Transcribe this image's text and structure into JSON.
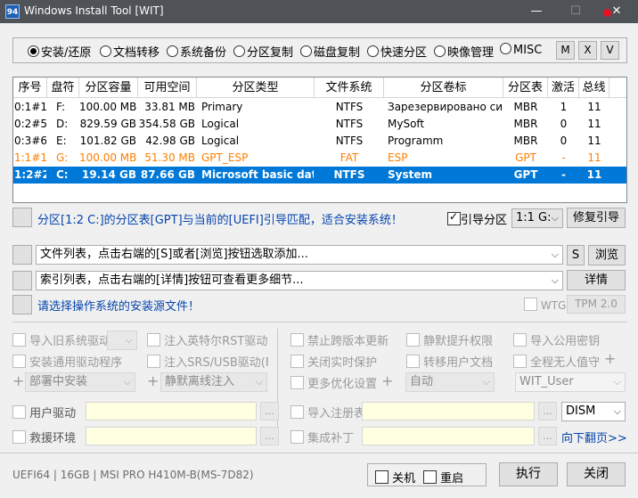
{
  "window": {
    "title": "Windows Install Tool [WIT]",
    "icon_label": "94",
    "minimize": "—",
    "maximize": "☐",
    "close": "✕",
    "close_dot_color": "#e81123"
  },
  "modes": {
    "options": [
      "安装/还原",
      "文档转移",
      "系统备份",
      "分区复制",
      "磁盘复制",
      "快速分区",
      "映像管理",
      "MISC"
    ],
    "selected_index": 0,
    "buttons": [
      "M",
      "X",
      "V"
    ]
  },
  "table": {
    "columns": [
      "序号",
      "盘符",
      "分区容量",
      "可用空间",
      "分区类型",
      "文件系统",
      "分区卷标",
      "分区表",
      "激活",
      "总线"
    ],
    "rows": [
      [
        "0:1#1",
        "F:",
        "100.00 MB",
        "33.81 MB",
        "Primary",
        "NTFS",
        "Зарезервировано сис",
        "MBR",
        "1",
        "11"
      ],
      [
        "0:2#5",
        "D:",
        "829.59 GB",
        "354.58 GB",
        "Logical",
        "NTFS",
        "MySoft",
        "MBR",
        "0",
        "11"
      ],
      [
        "0:3#6",
        "E:",
        "101.82 GB",
        "42.98 GB",
        "Logical",
        "NTFS",
        "Programm",
        "MBR",
        "0",
        "11"
      ],
      [
        "1:1#1",
        "G:",
        "100.00 MB",
        "51.30 MB",
        "GPT_ESP",
        "FAT",
        "ESP",
        "GPT",
        "-",
        "11"
      ],
      [
        "1:2#2",
        "C:",
        "19.14 GB",
        "87.66 GB",
        "Microsoft basic data",
        "NTFS",
        "System",
        "GPT",
        "-",
        "11"
      ]
    ],
    "selected_row": 4,
    "highlight_row": 3,
    "colors": {
      "selected_bg": "#0078d7",
      "esp_text": "#ff7f00"
    }
  },
  "status_line": {
    "text": "分区[1:2 C:]的分区表[GPT]与当前的[UEFI]引导匹配，适合安装系统！",
    "boot_checkbox_label": "引导分区",
    "boot_select": "1:1 G:",
    "repair_button": "修复引导"
  },
  "file_list": {
    "placeholder": "文件列表，点击右端的[S]或者[浏览]按钮选取添加...",
    "s_button": "S",
    "browse_button": "浏览"
  },
  "index_list": {
    "placeholder": "索引列表，点击右端的[详情]按钮可查看更多细节...",
    "detail_button": "详情"
  },
  "source_prompt": {
    "text": "请选择操作系统的安装源文件！",
    "wtg_label": "WTG",
    "tpm_button": "TPM 2.0"
  },
  "options": {
    "col1": [
      "导入旧系统驱动",
      "安装通用驱动程序"
    ],
    "col2": [
      "注入英特尔RST驱动",
      "注入SRS/USB驱动(F"
    ],
    "col3": [
      "禁止跨版本更新",
      "关闭实时保护",
      "更多优化设置"
    ],
    "col4": [
      "静默提升权限",
      "转移用户文档"
    ],
    "col5": [
      "导入公用密钥",
      "全程无人值守"
    ],
    "deploy_select": "部署中安装",
    "inject_select": "静默离线注入",
    "auto_select": "自动",
    "user_select": "WIT_User",
    "plus": "+"
  },
  "bottom_fields": {
    "user_driver_label": "用户驱动",
    "rescue_label": "救援环境",
    "import_reg_label": "导入注册表",
    "patch_label": "集成补丁",
    "dots": "...",
    "dism_select": "DISM",
    "next_page_link": "向下翻页>>"
  },
  "footer": {
    "sysinfo": "UEFI64 | 16GB | MSI PRO H410M-B(MS-7D82)",
    "shutdown_label": "关机",
    "reboot_label": "重启",
    "execute_button": "执行",
    "close_button": "关闭"
  }
}
